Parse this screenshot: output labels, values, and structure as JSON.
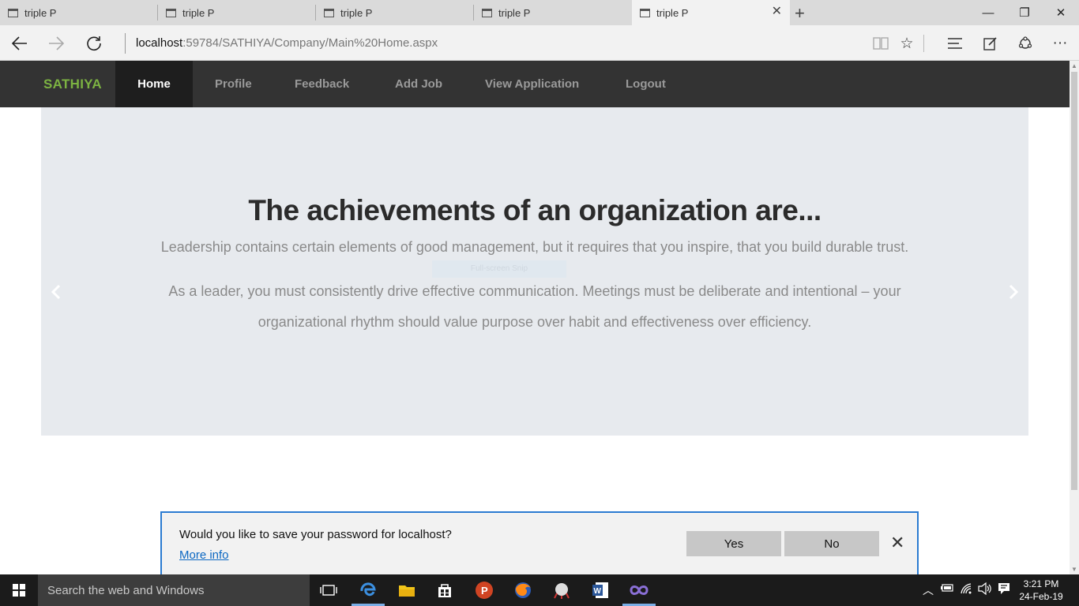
{
  "browser": {
    "tabs": [
      {
        "title": "triple P",
        "active": false
      },
      {
        "title": "triple P",
        "active": false
      },
      {
        "title": "triple P",
        "active": false
      },
      {
        "title": "triple P",
        "active": false
      },
      {
        "title": "triple P",
        "active": true
      }
    ],
    "url_host": "localhost",
    "url_rest": ":59784/SATHIYA/Company/Main%20Home.aspx"
  },
  "site": {
    "brand": "SATHIYA",
    "brand_color": "#7cb342",
    "nav": [
      "Home",
      "Profile",
      "Feedback",
      "Add Job",
      "View Application",
      "Logout"
    ],
    "active_nav": "Home"
  },
  "hero": {
    "heading": "The achievements of an organization are...",
    "para1": "Leadership contains certain elements of good management, but it requires that you inspire, that you build durable trust.",
    "para2": "As a leader, you must consistently drive effective communication. Meetings must be deliberate and intentional – your organizational rhythm should value purpose over habit and effectiveness over efficiency.",
    "ghost_text": "Full-screen Snip"
  },
  "password_prompt": {
    "question": "Would you like to save your password for localhost?",
    "more_info": "More info",
    "yes": "Yes",
    "no": "No"
  },
  "taskbar": {
    "search_placeholder": "Search the web and Windows",
    "time": "3:21 PM",
    "date": "24-Feb-19"
  }
}
